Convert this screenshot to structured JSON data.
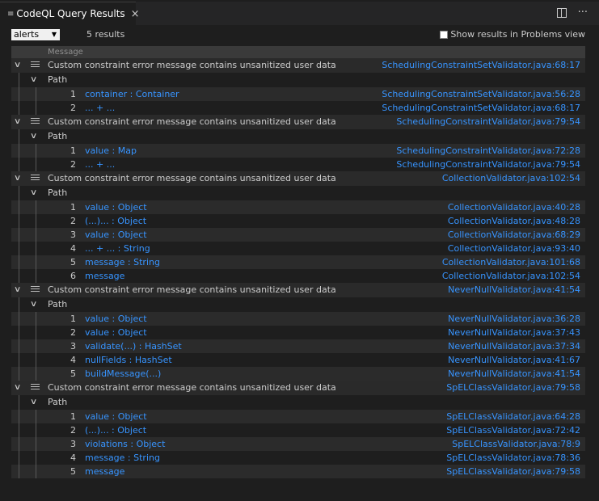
{
  "tab": {
    "icon": "list-icon",
    "title": "CodeQL Query Results",
    "close_label": "×"
  },
  "actions": {
    "more_label": "···"
  },
  "toolbar": {
    "select_value": "alerts",
    "result_count": "5 results",
    "problems_label": "Show results in Problems view"
  },
  "table": {
    "header": "Message",
    "path_label": "Path"
  },
  "alerts": [
    {
      "message": "Custom constraint error message contains unsanitized user data",
      "location": "SchedulingConstraintSetValidator.java:68:17",
      "steps": [
        {
          "num": "1",
          "text": "container : Container",
          "location": "SchedulingConstraintSetValidator.java:56:28"
        },
        {
          "num": "2",
          "text": "... + ...",
          "location": "SchedulingConstraintSetValidator.java:68:17"
        }
      ]
    },
    {
      "message": "Custom constraint error message contains unsanitized user data",
      "location": "SchedulingConstraintValidator.java:79:54",
      "steps": [
        {
          "num": "1",
          "text": "value : Map",
          "location": "SchedulingConstraintValidator.java:72:28"
        },
        {
          "num": "2",
          "text": "... + ...",
          "location": "SchedulingConstraintValidator.java:79:54"
        }
      ]
    },
    {
      "message": "Custom constraint error message contains unsanitized user data",
      "location": "CollectionValidator.java:102:54",
      "steps": [
        {
          "num": "1",
          "text": "value : Object",
          "location": "CollectionValidator.java:40:28"
        },
        {
          "num": "2",
          "text": "(...)... : Object",
          "location": "CollectionValidator.java:48:28"
        },
        {
          "num": "3",
          "text": "value : Object",
          "location": "CollectionValidator.java:68:29"
        },
        {
          "num": "4",
          "text": "... + ... : String",
          "location": "CollectionValidator.java:93:40"
        },
        {
          "num": "5",
          "text": "message : String",
          "location": "CollectionValidator.java:101:68"
        },
        {
          "num": "6",
          "text": "message",
          "location": "CollectionValidator.java:102:54"
        }
      ]
    },
    {
      "message": "Custom constraint error message contains unsanitized user data",
      "location": "NeverNullValidator.java:41:54",
      "steps": [
        {
          "num": "1",
          "text": "value : Object",
          "location": "NeverNullValidator.java:36:28"
        },
        {
          "num": "2",
          "text": "value : Object",
          "location": "NeverNullValidator.java:37:43"
        },
        {
          "num": "3",
          "text": "validate(...) : HashSet",
          "location": "NeverNullValidator.java:37:34"
        },
        {
          "num": "4",
          "text": "nullFields : HashSet",
          "location": "NeverNullValidator.java:41:67"
        },
        {
          "num": "5",
          "text": "buildMessage(...)",
          "location": "NeverNullValidator.java:41:54"
        }
      ]
    },
    {
      "message": "Custom constraint error message contains unsanitized user data",
      "location": "SpELClassValidator.java:79:58",
      "steps": [
        {
          "num": "1",
          "text": "value : Object",
          "location": "SpELClassValidator.java:64:28"
        },
        {
          "num": "2",
          "text": "(...)... : Object",
          "location": "SpELClassValidator.java:72:42"
        },
        {
          "num": "3",
          "text": "violations : Object",
          "location": "SpELClassValidator.java:78:9"
        },
        {
          "num": "4",
          "text": "message : String",
          "location": "SpELClassValidator.java:78:36"
        },
        {
          "num": "5",
          "text": "message",
          "location": "SpELClassValidator.java:79:58"
        }
      ]
    }
  ]
}
